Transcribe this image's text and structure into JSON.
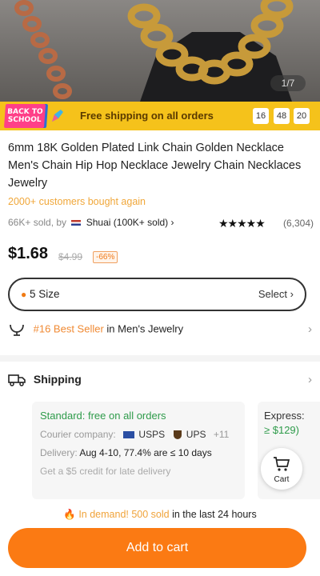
{
  "gallery": {
    "counter": "1/7"
  },
  "promo_bar": {
    "badge": "BACK TO SCHOOL",
    "text": "Free shipping on all orders",
    "timer": [
      "16",
      "48",
      "20"
    ]
  },
  "product": {
    "title": "6mm 18K Golden Plated Link Chain Golden Necklace Men's Chain Hip Hop Necklace Jewelry Chain Necklaces Jewelry",
    "bought_again": "2000+ customers bought again",
    "sold": "66K+ sold, by",
    "store": "Shuai (100K+ sold)",
    "rating_stars": "★★★★★",
    "rating_count": "(6,304)",
    "price": "$1.68",
    "old_price": "$4.99",
    "discount": "-66%"
  },
  "size_selector": {
    "label": "5 Size",
    "action": "Select"
  },
  "bestseller": {
    "rank": "#16 Best Seller",
    "category": "in Men's Jewelry"
  },
  "shipping": {
    "title": "Shipping",
    "standard": "Standard: free on all orders",
    "courier_label": "Courier company:",
    "couriers": [
      "USPS",
      "UPS"
    ],
    "courier_more": "+11",
    "delivery_label": "Delivery:",
    "delivery_value": "Aug 4-10, 77.4% are ≤ 10 days",
    "credit": "Get a $5 credit for late delivery",
    "express_label": "Express:",
    "express_value": "≥ $129)"
  },
  "cart": {
    "label": "Cart"
  },
  "demand": {
    "highlight": "In demand! 500 sold",
    "rest": "in the last 24 hours"
  },
  "cta": {
    "label": "Add to cart"
  },
  "colors": {
    "orange": "#fb7a13",
    "promo_yellow": "#f5c21b",
    "green": "#2e9b4a"
  }
}
